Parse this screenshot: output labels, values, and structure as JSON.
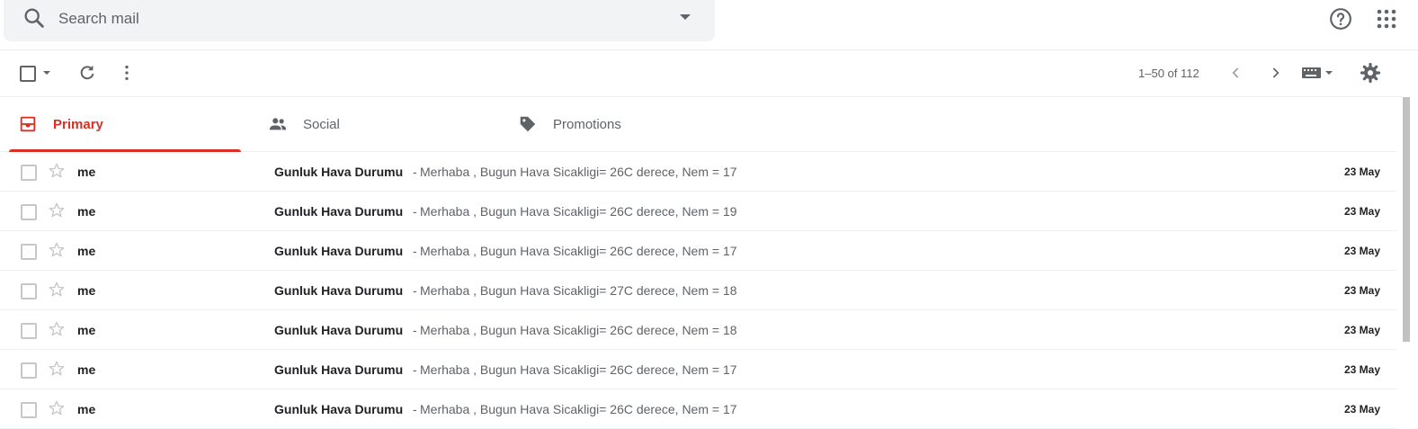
{
  "search": {
    "placeholder": "Search mail"
  },
  "header": {
    "help_icon": "help-circle-icon",
    "apps_icon": "apps-grid-icon"
  },
  "toolbar": {
    "pagination": "1–50 of 112"
  },
  "tabs": [
    {
      "label": "Primary",
      "icon": "inbox-icon",
      "active": true
    },
    {
      "label": "Social",
      "icon": "people-icon",
      "active": false
    },
    {
      "label": "Promotions",
      "icon": "tag-icon",
      "active": false
    }
  ],
  "emails": [
    {
      "sender": "me",
      "subject": "Gunluk Hava Durumu",
      "separator": "-",
      "snippet": "Merhaba , Bugun Hava Sicakligi= 26C derece, Nem = 17",
      "date": "23 May"
    },
    {
      "sender": "me",
      "subject": "Gunluk Hava Durumu",
      "separator": "-",
      "snippet": "Merhaba , Bugun Hava Sicakligi= 26C derece, Nem = 19",
      "date": "23 May"
    },
    {
      "sender": "me",
      "subject": "Gunluk Hava Durumu",
      "separator": "-",
      "snippet": "Merhaba , Bugun Hava Sicakligi= 26C derece, Nem = 17",
      "date": "23 May"
    },
    {
      "sender": "me",
      "subject": "Gunluk Hava Durumu",
      "separator": "-",
      "snippet": "Merhaba , Bugun Hava Sicakligi= 27C derece, Nem = 18",
      "date": "23 May"
    },
    {
      "sender": "me",
      "subject": "Gunluk Hava Durumu",
      "separator": "-",
      "snippet": "Merhaba , Bugun Hava Sicakligi= 26C derece, Nem = 18",
      "date": "23 May"
    },
    {
      "sender": "me",
      "subject": "Gunluk Hava Durumu",
      "separator": "-",
      "snippet": "Merhaba , Bugun Hava Sicakligi= 26C derece, Nem = 17",
      "date": "23 May"
    },
    {
      "sender": "me",
      "subject": "Gunluk Hava Durumu",
      "separator": "-",
      "snippet": "Merhaba , Bugun Hava Sicakligi= 26C derece, Nem = 17",
      "date": "23 May"
    }
  ],
  "colors": {
    "accent": "#d93025",
    "text_secondary": "#5f6368"
  }
}
